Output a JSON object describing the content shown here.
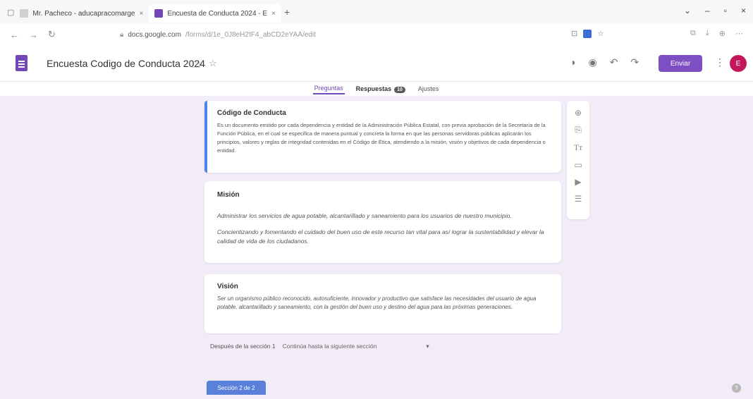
{
  "browser": {
    "tabs": [
      {
        "label": "Mr. Pacheco - aducapracomarge"
      },
      {
        "label": "Encuesta de Conducta 2024 - E"
      }
    ],
    "url_host": "docs.google.com",
    "url_path": "/forms/d/1e_0J8eH2tF4_abCD2eYAA/edit"
  },
  "header": {
    "title": "Encuesta Codigo de Conducta 2024",
    "send_label": "Enviar",
    "avatar_initial": "E"
  },
  "tabs": {
    "preguntas": "Preguntas",
    "respuestas": "Respuestas",
    "respuestas_count": "10",
    "ajustes": "Ajustes"
  },
  "cards": {
    "codigo": {
      "title": "Código de Conducta",
      "body": "Es un documento emitido por cada dependencia y entidad de la Administración Pública Estatal, con previa aprobación de la Secretaría de la Función Pública, en el cual se especifica de manera puntual y concreta la forma en que las personas servidoras públicas aplicarán los principios, valores y reglas de integridad contenidas en el Código de Ética, atendiendo a la misión, visión y objetivos de cada dependencia o entidad."
    },
    "mision": {
      "title": "Misión",
      "p1": "Administrar los servicios de agua potable, alcantarillado y saneamiento para los usuarios de nuestro municipio.",
      "p2": "Concientizando y fomentando el cuidado del buen uso de este recurso tan vital para así lograr la sustentabilidad y elevar la calidad de vida de los ciudadanos."
    },
    "vision": {
      "title": "Visión",
      "body": "Ser un organismo público reconocido, autosuficiente, innovador y productivo que satisface las necesidades del usuario de agua potable, alcantarillado y saneamiento, con la gestión del buen uso y destino del agua para las próximas generaciones."
    }
  },
  "after_section": {
    "label": "Después de la sección 1",
    "value": "Continúa hasta la siguiente sección"
  },
  "section_pill": "Sección 2 de 2",
  "colors": {
    "accent": "#7248b9",
    "active_bar": "#4c84e8",
    "send": "#7d4fc3",
    "background": "#f1ecf7"
  }
}
